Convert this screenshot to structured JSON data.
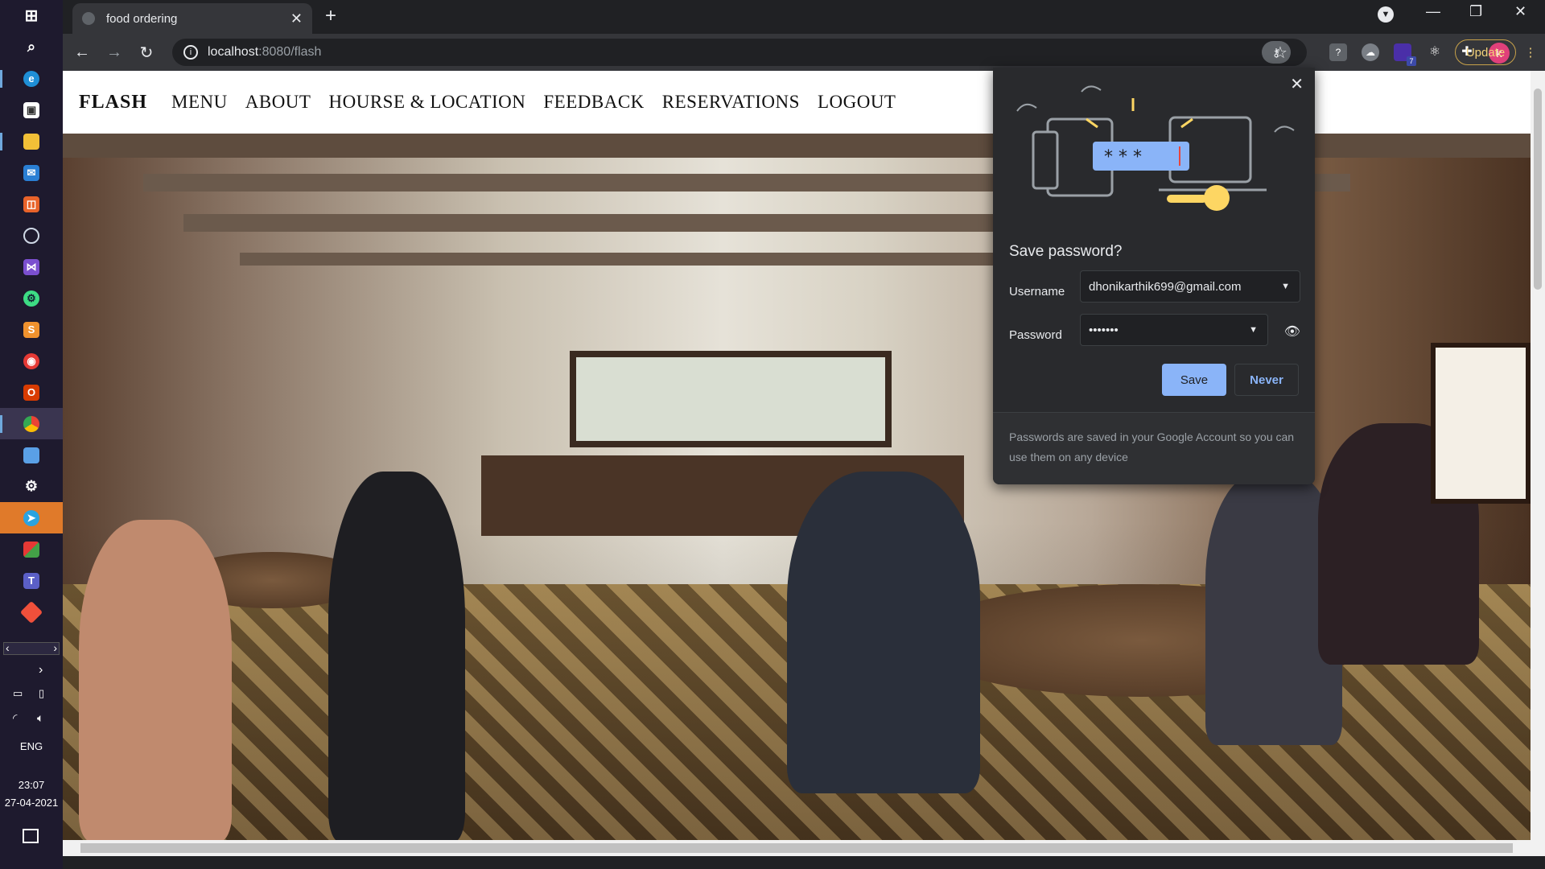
{
  "taskbar": {
    "icons": [
      "windows-icon",
      "search-icon",
      "edge-icon",
      "store-icon",
      "file-explorer-icon",
      "mail-icon",
      "office-icon",
      "media-icon",
      "visual-studio-icon",
      "android-studio-icon",
      "sublime-icon",
      "app-red-icon",
      "office-red-icon",
      "chrome-icon",
      "folder-icon",
      "settings-icon",
      "telegram-icon",
      "apps-icon",
      "teams-icon",
      "git-icon"
    ],
    "language": "ENG",
    "time": "23:07",
    "date": "27-04-2021"
  },
  "browser": {
    "tab_title": "food ordering",
    "url_host": "localhost",
    "url_path": ":8080/flash",
    "update_label": "Update",
    "avatar_letter": "k",
    "extension_badge": "7"
  },
  "site": {
    "brand": "FLASH",
    "nav": [
      "MENU",
      "ABOUT",
      "HOURSE & LOCATION",
      "FEEDBACK",
      "RESERVATIONS",
      "LOGOUT"
    ]
  },
  "password_bubble": {
    "title": "Save password?",
    "username_label": "Username",
    "username_value": "dhonikarthik699@gmail.com",
    "password_label": "Password",
    "password_value": "•••••••",
    "save_label": "Save",
    "never_label": "Never",
    "footer": "Passwords are saved in your Google Account so you can use them on any device",
    "illustration_stars": "* * *"
  },
  "colors": {
    "accent": "#8ab4f8",
    "update_border": "#c8a24a",
    "avatar": "#e0407a"
  }
}
